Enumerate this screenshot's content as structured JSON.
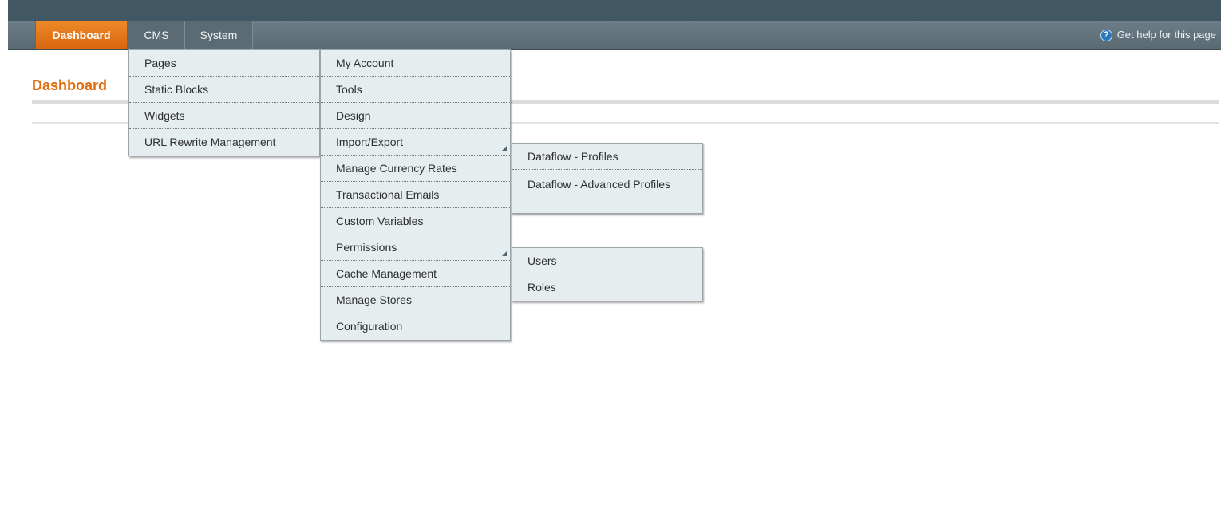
{
  "nav": {
    "tabs": [
      "Dashboard",
      "CMS",
      "System"
    ],
    "help_label": "Get help for this page",
    "help_icon": "question-circle-icon",
    "active_color": "#e06b0c"
  },
  "page": {
    "title": "Dashboard"
  },
  "cms_menu": {
    "items": [
      "Pages",
      "Static Blocks",
      "Widgets",
      "URL Rewrite Management"
    ]
  },
  "system_menu": {
    "items": [
      "My Account",
      "Tools",
      "Design",
      "Import/Export",
      "Manage Currency Rates",
      "Transactional Emails",
      "Custom Variables",
      "Permissions",
      "Cache Management",
      "Manage Stores",
      "Configuration"
    ]
  },
  "import_export_menu": {
    "items": [
      "Dataflow - Profiles",
      "Dataflow - Advanced Profiles"
    ]
  },
  "permissions_menu": {
    "items": [
      "Users",
      "Roles"
    ]
  }
}
